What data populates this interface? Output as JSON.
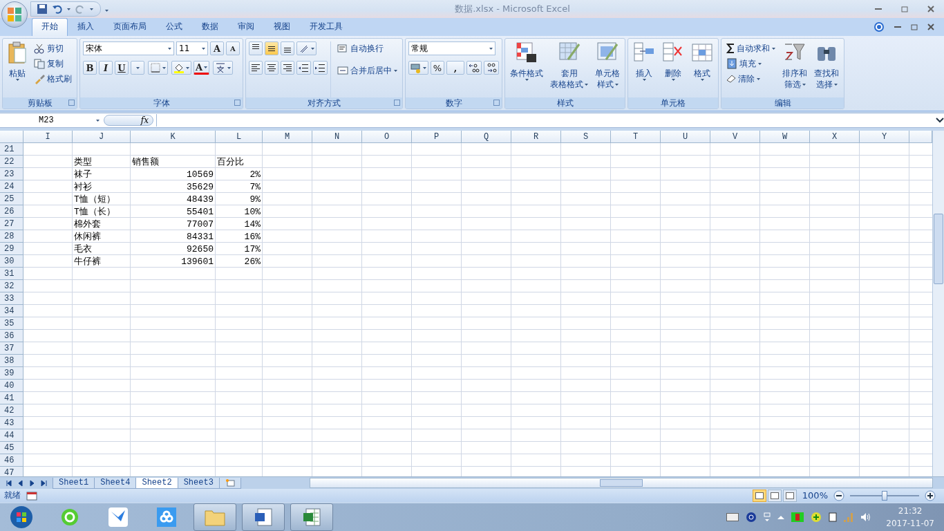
{
  "window": {
    "title": "数据.xlsx - Microsoft Excel"
  },
  "tabs": [
    {
      "label": "开始",
      "selected": true
    },
    {
      "label": "插入",
      "selected": false
    },
    {
      "label": "页面布局",
      "selected": false
    },
    {
      "label": "公式",
      "selected": false
    },
    {
      "label": "数据",
      "selected": false
    },
    {
      "label": "审阅",
      "selected": false
    },
    {
      "label": "视图",
      "selected": false
    },
    {
      "label": "开发工具",
      "selected": false
    }
  ],
  "ribbon": [
    {
      "kind": "clipboard",
      "label": "剪贴板",
      "paste": "粘贴",
      "items": [
        "剪切",
        "复制",
        "格式刷"
      ]
    },
    {
      "kind": "font",
      "label": "字体",
      "font": "宋体",
      "size": "11",
      "grow": "A",
      "shrink": "A",
      "bold": "B",
      "italic": "I",
      "underline": "U",
      "font_color": "A"
    },
    {
      "kind": "align",
      "label": "对齐方式",
      "vertical": [
        {
          "selected": false
        },
        {
          "selected": true
        },
        {
          "selected": false
        }
      ],
      "wrap": "自动换行",
      "merge": "合并后居中"
    },
    {
      "kind": "number",
      "label": "数字",
      "format": "常规",
      "percent": "%",
      "comma": ","
    },
    {
      "kind": "styles",
      "label": "样式",
      "buttons": [
        {
          "lines": [
            "条件格式"
          ]
        },
        {
          "lines": [
            "套用",
            "表格格式"
          ]
        },
        {
          "lines": [
            "单元格",
            "样式"
          ]
        }
      ]
    },
    {
      "kind": "cells",
      "label": "单元格",
      "buttons": [
        {
          "lines": [
            "插入"
          ]
        },
        {
          "lines": [
            "删除"
          ]
        },
        {
          "lines": [
            "格式"
          ]
        }
      ]
    },
    {
      "kind": "editing",
      "label": "编辑",
      "items": [
        "自动求和",
        "填充",
        "清除"
      ],
      "buttons": [
        {
          "lines": [
            "排序和",
            "筛选"
          ]
        },
        {
          "lines": [
            "查找和",
            "选择"
          ]
        }
      ]
    }
  ],
  "formula_bar": {
    "name_box": "M23",
    "function_label": "fx"
  },
  "columns": [
    "I",
    "J",
    "K",
    "L",
    "M",
    "N",
    "O",
    "P",
    "Q",
    "R",
    "S",
    "T",
    "U",
    "V",
    "W",
    "X",
    "Y"
  ],
  "rows": [
    {
      "number": "21"
    },
    {
      "number": "22",
      "kind": "header",
      "item": "类型",
      "sales": "销售额",
      "share": "百分比"
    },
    {
      "number": "23",
      "kind": "data",
      "item": "袜子",
      "sales": "10569",
      "share": "2%"
    },
    {
      "number": "24",
      "kind": "data",
      "item": "衬衫",
      "sales": "35629",
      "share": "7%"
    },
    {
      "number": "25",
      "kind": "data",
      "item": "T恤（短）",
      "sales": "48439",
      "share": "9%"
    },
    {
      "number": "26",
      "kind": "data",
      "item": "T恤（长）",
      "sales": "55401",
      "share": "10%"
    },
    {
      "number": "27",
      "kind": "data",
      "item": "棉外套",
      "sales": "77007",
      "share": "14%"
    },
    {
      "number": "28",
      "kind": "data",
      "item": "休闲裤",
      "sales": "84331",
      "share": "16%"
    },
    {
      "number": "29",
      "kind": "data",
      "item": "毛衣",
      "sales": "92650",
      "share": "17%"
    },
    {
      "number": "30",
      "kind": "data",
      "item": "牛仔裤",
      "sales": "139601",
      "share": "26%"
    },
    {
      "number": "31"
    },
    {
      "number": "32"
    },
    {
      "number": "33"
    },
    {
      "number": "34"
    },
    {
      "number": "35"
    },
    {
      "number": "36"
    },
    {
      "number": "37"
    },
    {
      "number": "38"
    },
    {
      "number": "39"
    },
    {
      "number": "40"
    },
    {
      "number": "41"
    },
    {
      "number": "42"
    },
    {
      "number": "43"
    },
    {
      "number": "44"
    },
    {
      "number": "45"
    },
    {
      "number": "46"
    },
    {
      "number": "47"
    }
  ],
  "sheets": [
    {
      "label": "Sheet1",
      "selected": false
    },
    {
      "label": "Sheet4",
      "selected": false
    },
    {
      "label": "Sheet2",
      "selected": true
    },
    {
      "label": "Sheet3",
      "selected": false
    }
  ],
  "status_bar": {
    "text": "就绪",
    "views": [
      {
        "selected": true
      },
      {
        "selected": false
      },
      {
        "selected": false
      }
    ],
    "zoom": "100%",
    "zoom_slider": {
      "level": 0.5
    }
  },
  "taskbar": {
    "time": "21:32",
    "date": "2017-11-07"
  }
}
